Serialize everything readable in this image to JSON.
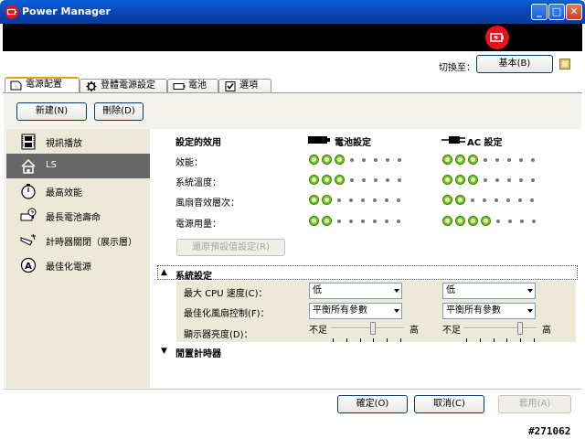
{
  "window": {
    "title": "Power Manager"
  },
  "header": {
    "switch_label": "切換至：",
    "switch_button": "基本(B)"
  },
  "tabs": [
    {
      "label": "電源配置",
      "icon": "power-plan-icon"
    },
    {
      "label": "登體電源設定",
      "icon": "gear-icon"
    },
    {
      "label": "電池",
      "icon": "battery-icon"
    },
    {
      "label": "選項",
      "icon": "checkbox-icon"
    }
  ],
  "toolbar": {
    "new": "新建(N)",
    "delete": "刪除(D)"
  },
  "plans": [
    {
      "label": "視訊播放",
      "icon": "film-icon"
    },
    {
      "label": "LS",
      "icon": "home-icon",
      "selected": true
    },
    {
      "label": "最高效能",
      "icon": "stopwatch-icon"
    },
    {
      "label": "最長電池壽命",
      "icon": "battery-clock-icon"
    },
    {
      "label": "計時器關閉（展示層）",
      "icon": "timer-off-icon"
    },
    {
      "label": "最佳化電源",
      "icon": "auto-power-icon"
    }
  ],
  "effects": {
    "heading": "設定的效用",
    "battery_heading": "電池設定",
    "ac_heading": "AC 設定",
    "rows": [
      {
        "label": "效能：",
        "battery": 3,
        "ac": 3,
        "total": 8
      },
      {
        "label": "系統溫度：",
        "battery": 3,
        "ac": 3,
        "total": 8
      },
      {
        "label": "風扇音效層次：",
        "battery": 2,
        "ac": 2,
        "total": 8
      },
      {
        "label": "電源用量：",
        "battery": 2,
        "ac": 4,
        "total": 8
      }
    ]
  },
  "restore_button": "還原預設值設定(R)",
  "system_settings": {
    "heading": "系統設定",
    "cpu_label": "最大 CPU 速度(C)：",
    "cpu_battery": "低",
    "cpu_ac": "低",
    "fan_label": "最佳化風扇控制(F)：",
    "fan_battery": "平衡所有參數",
    "fan_ac": "平衡所有參數",
    "brightness_label": "顯示器亮度(D)：",
    "brightness_low": "不足",
    "brightness_high": "高",
    "brightness_battery_fraction": 0.6,
    "brightness_ac_fraction": 0.8
  },
  "idle_timers": {
    "heading": "閒置計時器"
  },
  "footer": {
    "ok": "確定(O)",
    "cancel": "取消(C)",
    "apply": "套用(A)"
  },
  "watermark": "#271062",
  "colors": {
    "titlebar": "#0847b8",
    "dot_on": "#74c62a",
    "selected_plan": "#676767",
    "banner_icon": "#e8121a"
  }
}
